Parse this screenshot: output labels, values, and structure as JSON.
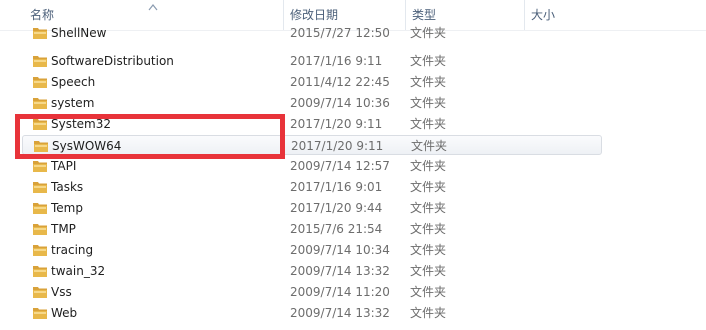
{
  "columns": {
    "name": "名称",
    "date": "修改日期",
    "type": "类型",
    "size": "大小"
  },
  "files": [
    {
      "name": "ShellNew",
      "date": "2015/7/27 12:50",
      "type": "文件夹"
    },
    {
      "name": "SoftwareDistribution",
      "date": "2017/1/16 9:11",
      "type": "文件夹"
    },
    {
      "name": "Speech",
      "date": "2011/4/12 22:45",
      "type": "文件夹"
    },
    {
      "name": "system",
      "date": "2009/7/14 10:36",
      "type": "文件夹"
    },
    {
      "name": "System32",
      "date": "2017/1/20 9:11",
      "type": "文件夹"
    },
    {
      "name": "SysWOW64",
      "date": "2017/1/20 9:11",
      "type": "文件夹"
    },
    {
      "name": "TAPI",
      "date": "2009/7/14 12:57",
      "type": "文件夹"
    },
    {
      "name": "Tasks",
      "date": "2017/1/16 9:01",
      "type": "文件夹"
    },
    {
      "name": "Temp",
      "date": "2017/1/20 9:44",
      "type": "文件夹"
    },
    {
      "name": "TMP",
      "date": "2015/7/6 21:54",
      "type": "文件夹"
    },
    {
      "name": "tracing",
      "date": "2009/7/14 10:34",
      "type": "文件夹"
    },
    {
      "name": "twain_32",
      "date": "2009/7/14 13:32",
      "type": "文件夹"
    },
    {
      "name": "Vss",
      "date": "2009/7/14 11:20",
      "type": "文件夹"
    },
    {
      "name": "Web",
      "date": "2009/7/14 13:32",
      "type": "文件夹"
    }
  ],
  "selected_item": "SysWOW64",
  "highlight_color": "#e8333a",
  "folder_color": "#e8b84a"
}
